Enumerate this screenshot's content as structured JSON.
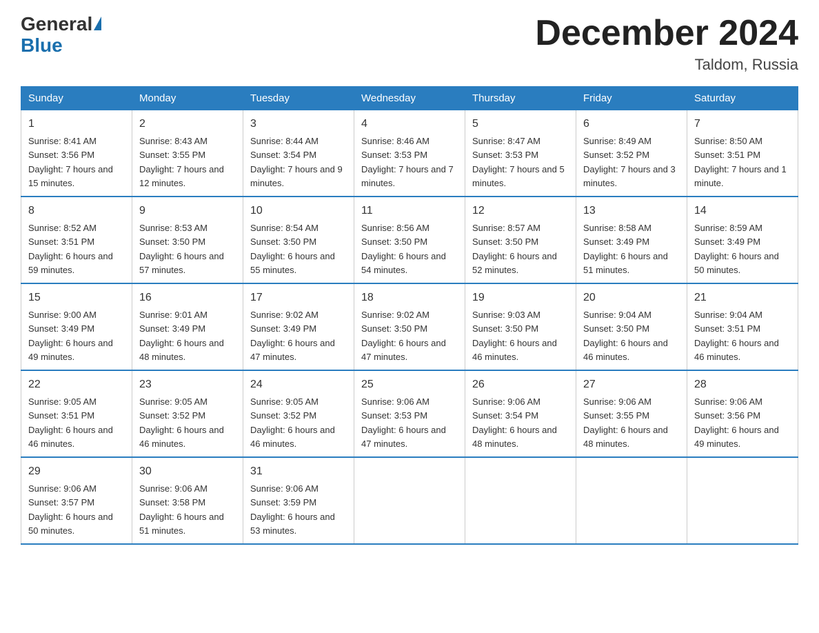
{
  "logo": {
    "general": "General",
    "blue": "Blue"
  },
  "title": "December 2024",
  "location": "Taldom, Russia",
  "days_of_week": [
    "Sunday",
    "Monday",
    "Tuesday",
    "Wednesday",
    "Thursday",
    "Friday",
    "Saturday"
  ],
  "weeks": [
    [
      {
        "num": "1",
        "sunrise": "8:41 AM",
        "sunset": "3:56 PM",
        "daylight": "7 hours and 15 minutes."
      },
      {
        "num": "2",
        "sunrise": "8:43 AM",
        "sunset": "3:55 PM",
        "daylight": "7 hours and 12 minutes."
      },
      {
        "num": "3",
        "sunrise": "8:44 AM",
        "sunset": "3:54 PM",
        "daylight": "7 hours and 9 minutes."
      },
      {
        "num": "4",
        "sunrise": "8:46 AM",
        "sunset": "3:53 PM",
        "daylight": "7 hours and 7 minutes."
      },
      {
        "num": "5",
        "sunrise": "8:47 AM",
        "sunset": "3:53 PM",
        "daylight": "7 hours and 5 minutes."
      },
      {
        "num": "6",
        "sunrise": "8:49 AM",
        "sunset": "3:52 PM",
        "daylight": "7 hours and 3 minutes."
      },
      {
        "num": "7",
        "sunrise": "8:50 AM",
        "sunset": "3:51 PM",
        "daylight": "7 hours and 1 minute."
      }
    ],
    [
      {
        "num": "8",
        "sunrise": "8:52 AM",
        "sunset": "3:51 PM",
        "daylight": "6 hours and 59 minutes."
      },
      {
        "num": "9",
        "sunrise": "8:53 AM",
        "sunset": "3:50 PM",
        "daylight": "6 hours and 57 minutes."
      },
      {
        "num": "10",
        "sunrise": "8:54 AM",
        "sunset": "3:50 PM",
        "daylight": "6 hours and 55 minutes."
      },
      {
        "num": "11",
        "sunrise": "8:56 AM",
        "sunset": "3:50 PM",
        "daylight": "6 hours and 54 minutes."
      },
      {
        "num": "12",
        "sunrise": "8:57 AM",
        "sunset": "3:50 PM",
        "daylight": "6 hours and 52 minutes."
      },
      {
        "num": "13",
        "sunrise": "8:58 AM",
        "sunset": "3:49 PM",
        "daylight": "6 hours and 51 minutes."
      },
      {
        "num": "14",
        "sunrise": "8:59 AM",
        "sunset": "3:49 PM",
        "daylight": "6 hours and 50 minutes."
      }
    ],
    [
      {
        "num": "15",
        "sunrise": "9:00 AM",
        "sunset": "3:49 PM",
        "daylight": "6 hours and 49 minutes."
      },
      {
        "num": "16",
        "sunrise": "9:01 AM",
        "sunset": "3:49 PM",
        "daylight": "6 hours and 48 minutes."
      },
      {
        "num": "17",
        "sunrise": "9:02 AM",
        "sunset": "3:49 PM",
        "daylight": "6 hours and 47 minutes."
      },
      {
        "num": "18",
        "sunrise": "9:02 AM",
        "sunset": "3:50 PM",
        "daylight": "6 hours and 47 minutes."
      },
      {
        "num": "19",
        "sunrise": "9:03 AM",
        "sunset": "3:50 PM",
        "daylight": "6 hours and 46 minutes."
      },
      {
        "num": "20",
        "sunrise": "9:04 AM",
        "sunset": "3:50 PM",
        "daylight": "6 hours and 46 minutes."
      },
      {
        "num": "21",
        "sunrise": "9:04 AM",
        "sunset": "3:51 PM",
        "daylight": "6 hours and 46 minutes."
      }
    ],
    [
      {
        "num": "22",
        "sunrise": "9:05 AM",
        "sunset": "3:51 PM",
        "daylight": "6 hours and 46 minutes."
      },
      {
        "num": "23",
        "sunrise": "9:05 AM",
        "sunset": "3:52 PM",
        "daylight": "6 hours and 46 minutes."
      },
      {
        "num": "24",
        "sunrise": "9:05 AM",
        "sunset": "3:52 PM",
        "daylight": "6 hours and 46 minutes."
      },
      {
        "num": "25",
        "sunrise": "9:06 AM",
        "sunset": "3:53 PM",
        "daylight": "6 hours and 47 minutes."
      },
      {
        "num": "26",
        "sunrise": "9:06 AM",
        "sunset": "3:54 PM",
        "daylight": "6 hours and 48 minutes."
      },
      {
        "num": "27",
        "sunrise": "9:06 AM",
        "sunset": "3:55 PM",
        "daylight": "6 hours and 48 minutes."
      },
      {
        "num": "28",
        "sunrise": "9:06 AM",
        "sunset": "3:56 PM",
        "daylight": "6 hours and 49 minutes."
      }
    ],
    [
      {
        "num": "29",
        "sunrise": "9:06 AM",
        "sunset": "3:57 PM",
        "daylight": "6 hours and 50 minutes."
      },
      {
        "num": "30",
        "sunrise": "9:06 AM",
        "sunset": "3:58 PM",
        "daylight": "6 hours and 51 minutes."
      },
      {
        "num": "31",
        "sunrise": "9:06 AM",
        "sunset": "3:59 PM",
        "daylight": "6 hours and 53 minutes."
      },
      null,
      null,
      null,
      null
    ]
  ]
}
